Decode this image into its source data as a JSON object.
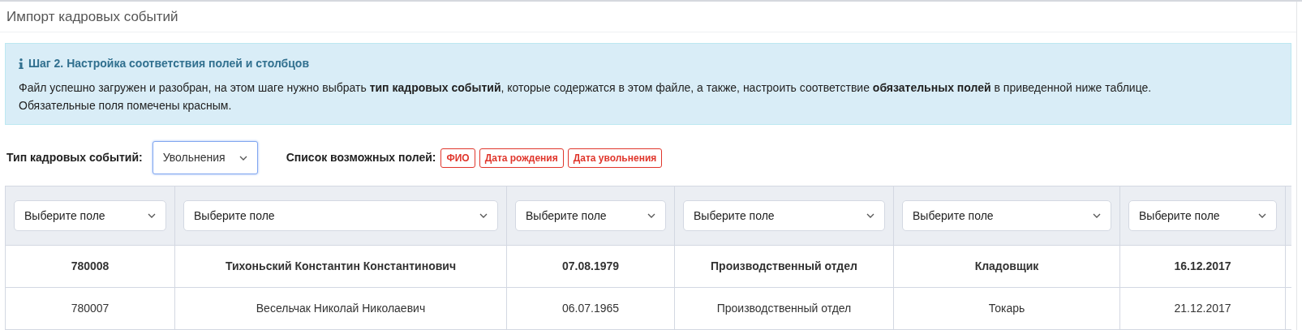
{
  "page_title": "Импорт кадровых событий",
  "info": {
    "heading": "Шаг 2. Настройка соответствия полей и столбцов",
    "text": "Файл успешно загружен и разобран, на этом шаге нужно выбрать **тип кадровых событий**, которые содержатся в этом файле, а также, настроить соответствие **обязательных полей** в приведенной ниже таблице. Обязательные поля помечены красным."
  },
  "event_type": {
    "label": "Тип кадровых событий:",
    "value": "Увольнения",
    "focused": true
  },
  "fields_label": "Список возможных полей:",
  "fields": [
    "ФИО",
    "Дата рождения",
    "Дата увольнения"
  ],
  "column_selects": [
    "Выберите поле",
    "Выберите поле",
    "Выберите поле",
    "Выберите поле",
    "Выберите поле",
    "Выберите поле"
  ],
  "rows": [
    {
      "bold": true,
      "cells": [
        "780008",
        "Тихоньский Константин Константинович",
        "07.08.1979",
        "Производственный отдел",
        "Кладовщик",
        "16.12.2017"
      ]
    },
    {
      "bold": false,
      "cells": [
        "780007",
        "Весельчак Николай Николаевич",
        "06.07.1965",
        "Производственный отдел",
        "Токарь",
        "21.12.2017"
      ]
    }
  ]
}
